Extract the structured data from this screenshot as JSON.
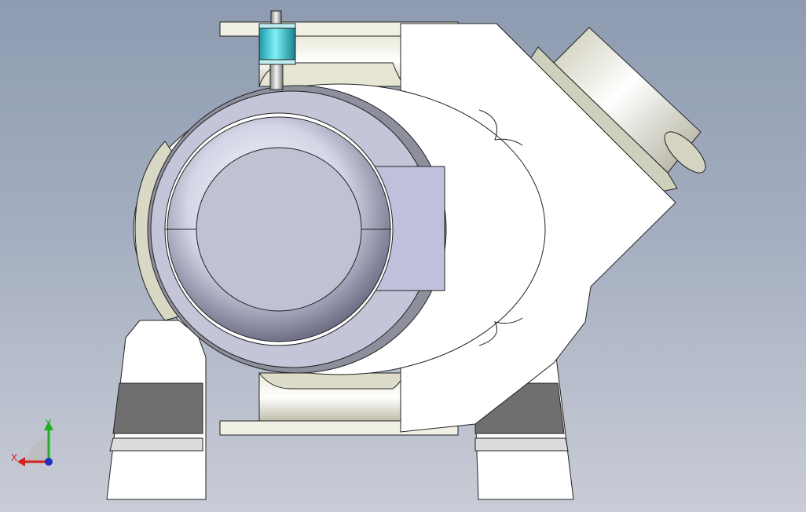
{
  "viewport": {
    "background_top": "#8e9bb0",
    "background_bottom": "#c9ccd6"
  },
  "model": {
    "body_color": "#ffffff",
    "bore_color": "#bfc0d4",
    "ball_color": "#c8c9db",
    "stem_sleeve_color": "#2ec4cc",
    "support_band_color": "#6f6f6f"
  },
  "triad": {
    "x_label": "X",
    "y_label": "Y",
    "x_color": "#d62020",
    "y_color": "#20b020",
    "z_color": "#2030c0"
  }
}
